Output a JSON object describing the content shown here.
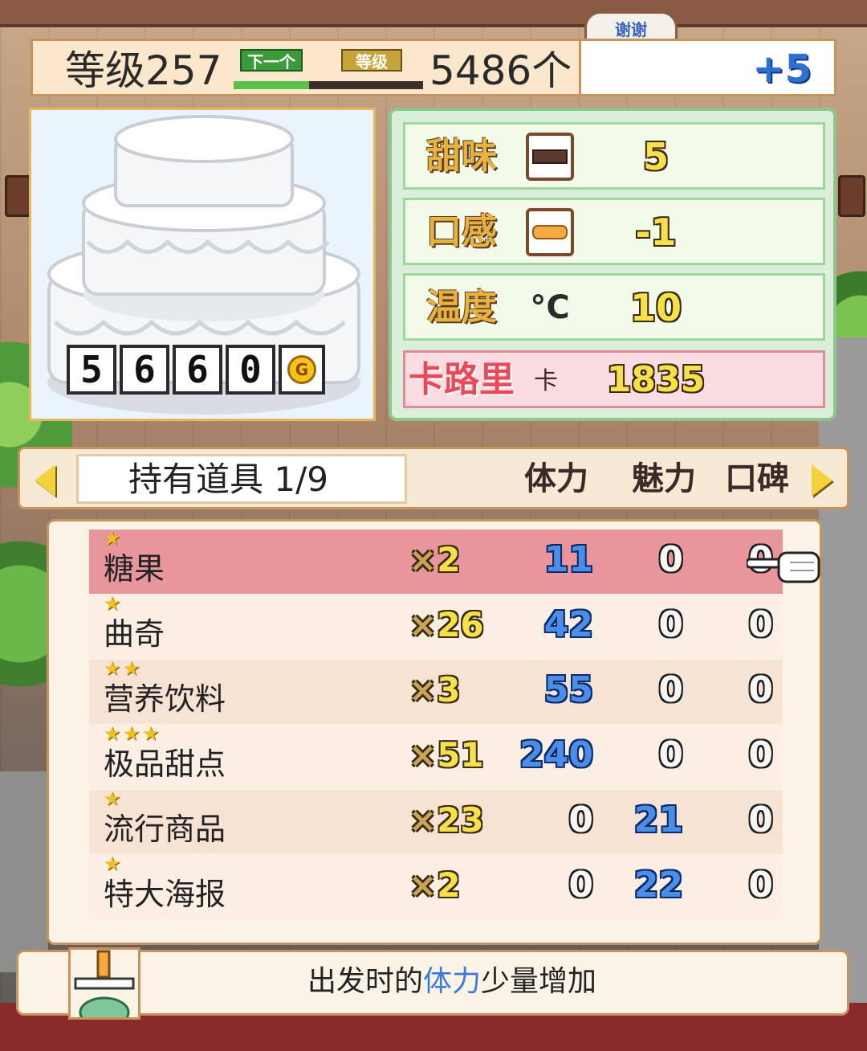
{
  "header": {
    "level_text": "等级257",
    "next_badge": "下一个",
    "grade_badge": "等级",
    "level_progress_percent": 40,
    "count_text": "5486个",
    "bonus_text": "+5",
    "thanks_text": "谢谢"
  },
  "cake": {
    "price_digits": [
      "5",
      "6",
      "6",
      "0"
    ],
    "price_unit": "G"
  },
  "stats": {
    "sweet": {
      "label": "甜味",
      "icon": "chocolate-bar-icon",
      "value": "5"
    },
    "texture": {
      "label": "口感",
      "icon": "bun-icon",
      "value": "-1"
    },
    "temperature": {
      "label": "温度",
      "icon": "°C",
      "value": "10"
    },
    "calorie": {
      "label": "卡路里",
      "unit": "卡",
      "value": "1835"
    }
  },
  "tab": {
    "title": "持有道具 1/9",
    "col_stamina": "体力",
    "col_charm": "魅力",
    "col_reputation": "口碑"
  },
  "items": [
    {
      "stars": 1,
      "name": "糖果",
      "qty": "2",
      "stamina": "11",
      "charm": "0",
      "reputation": "0",
      "selected": true
    },
    {
      "stars": 1,
      "name": "曲奇",
      "qty": "26",
      "stamina": "42",
      "charm": "0",
      "reputation": "0"
    },
    {
      "stars": 2,
      "name": "营养饮料",
      "qty": "3",
      "stamina": "55",
      "charm": "0",
      "reputation": "0"
    },
    {
      "stars": 3,
      "name": "极品甜点",
      "qty": "51",
      "stamina": "240",
      "charm": "0",
      "reputation": "0"
    },
    {
      "stars": 1,
      "name": "流行商品",
      "qty": "23",
      "stamina": "0",
      "charm": "21",
      "reputation": "0"
    },
    {
      "stars": 1,
      "name": "特大海报",
      "qty": "2",
      "stamina": "0",
      "charm": "22",
      "reputation": "0"
    }
  ],
  "description": {
    "prefix": "出发时的",
    "highlight": "体力",
    "suffix": "少量增加"
  },
  "colors": {
    "selected_row": "#e8969c",
    "value_blue": "#4a8ee8",
    "accent_yellow": "#f7e04a"
  }
}
